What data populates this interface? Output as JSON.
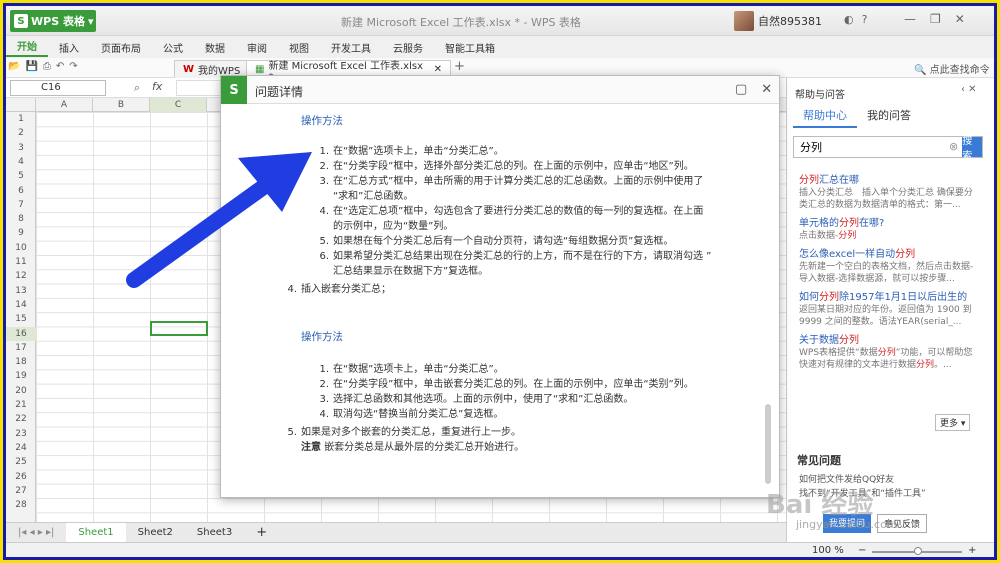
{
  "app": {
    "brand": "WPS 表格",
    "window_title": "新建 Microsoft Excel 工作表.xlsx * - WPS 表格",
    "user": "自然895381"
  },
  "menu": [
    "开始",
    "插入",
    "页面布局",
    "公式",
    "数据",
    "审阅",
    "视图",
    "开发工具",
    "云服务",
    "智能工具箱"
  ],
  "doc_tabs": [
    "我的WPS",
    "新建 Microsoft Excel 工作表.xlsx *"
  ],
  "find_cmd": "点此查找命令",
  "formula_bar": {
    "cell_ref": "C16",
    "fx": "fx"
  },
  "columns": [
    "A",
    "B",
    "C"
  ],
  "rows": [
    "1",
    "2",
    "3",
    "4",
    "5",
    "6",
    "7",
    "8",
    "9",
    "10",
    "11",
    "12",
    "13",
    "14",
    "15",
    "16",
    "17",
    "18",
    "19",
    "20",
    "21",
    "22",
    "23",
    "24",
    "25",
    "26",
    "27",
    "28"
  ],
  "sheets": [
    "Sheet1",
    "Sheet2",
    "Sheet3"
  ],
  "status": {
    "zoom": "100 %"
  },
  "dialog": {
    "title": "问题详情",
    "section1_title": "操作方法",
    "section1_items": [
      "在“数据”选项卡上，单击“分类汇总”。",
      "在“分类字段”框中，选择外部分类汇总的列。在上面的示例中，应单击“地区”列。",
      "在“汇总方式”框中，单击所需的用于计算分类汇总的汇总函数。上面的示例中使用了",
      "“求和”汇总函数。",
      "在“选定汇总项”框中，勾选包含了要进行分类汇总的数值的每一列的复选框。在上面",
      "的示例中，应为“数量”列。",
      "如果想在每个分类汇总后有一个自动分页符，请勾选“每组数据分页”复选框。",
      "如果希望分类汇总结果出现在分类汇总的行的上方，而不是在行的下方，请取消勾选 ”",
      "汇总结果显示在数据下方”复选框。"
    ],
    "step4": "插入嵌套分类汇总；",
    "section2_title": "操作方法",
    "section2_items": [
      "在“数据”选项卡上，单击“分类汇总”。",
      "在“分类字段”框中，单击嵌套分类汇总的列。在上面的示例中，应单击“类别”列。",
      "选择汇总函数和其他选项。上面的示例中，使用了“求和”汇总函数。",
      "取消勾选“替换当前分类汇总”复选框。"
    ],
    "step5": "如果是对多个嵌套的分类汇总，重复进行上一步。",
    "note_label": "注意",
    "note_text": "嵌套分类总是从最外层的分类汇总开始进行。"
  },
  "help_panel": {
    "title": "帮助与问答",
    "tab_help": "帮助中心",
    "tab_mine": "我的问答",
    "search_value": "分列",
    "search_btn": "搜索",
    "more": "更多",
    "faq_title": "常见问题",
    "faq_items": [
      "如何把文件发给QQ好友",
      "找不到“开发工具”和“插件工具”"
    ],
    "ask_btn": "我要提问",
    "feedback_btn": "意见反馈"
  },
  "watermark": "Bai 经验",
  "watermark_url": "jingyan.baidu.com",
  "colors": {
    "accent": "#3a9b3a",
    "link": "#2b5fb4",
    "frame_yellow": "#f4e200",
    "frame_blue": "#1a1aa8",
    "arrow": "#1f3de0"
  }
}
